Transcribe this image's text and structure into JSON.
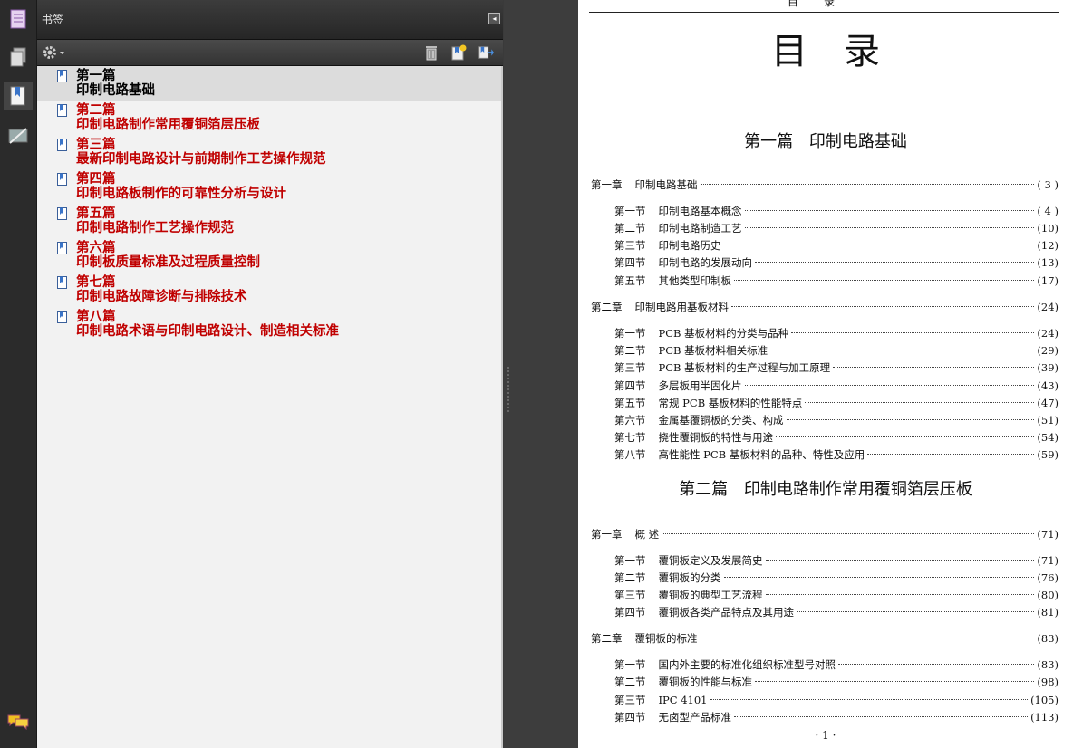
{
  "panel": {
    "title": "书签",
    "collapse_glyph": "◂"
  },
  "bookmarks": [
    {
      "line1": "第一篇",
      "line2": "印制电路基础",
      "selected": true
    },
    {
      "line1": "第二篇",
      "line2": "印制电路制作常用覆铜箔层压板"
    },
    {
      "line1": "第三篇",
      "line2": "最新印制电路设计与前期制作工艺操作规范"
    },
    {
      "line1": "第四篇",
      "line2": "印制电路板制作的可靠性分析与设计"
    },
    {
      "line1": "第五篇",
      "line2": "印制电路制作工艺操作规范"
    },
    {
      "line1": "第六篇",
      "line2": "印制板质量标准及过程质量控制"
    },
    {
      "line1": "第七篇",
      "line2": "印制电路故障诊断与排除技术"
    },
    {
      "line1": "第八篇",
      "line2": "印制电路术语与印制电路设计、制造相关标准"
    }
  ],
  "document": {
    "running_head": "目录",
    "title": "目录",
    "part1_title": "第一篇  印制电路基础",
    "part2_title": "第二篇  印制电路制作常用覆铜箔层压板",
    "folio": "· 1 ·",
    "toc": [
      {
        "label": "第一章",
        "title": "印制电路基础",
        "page": "( 3 )"
      },
      {
        "label": "第一节",
        "title": "印制电路基本概念",
        "page": "( 4 )"
      },
      {
        "label": "第二节",
        "title": "印制电路制造工艺",
        "page": "(10)"
      },
      {
        "label": "第三节",
        "title": "印制电路历史",
        "page": "(12)"
      },
      {
        "label": "第四节",
        "title": "印制电路的发展动向",
        "page": "(13)"
      },
      {
        "label": "第五节",
        "title": "其他类型印制板",
        "page": "(17)"
      },
      {
        "label": "第二章",
        "title": "印制电路用基板材料",
        "page": "(24)"
      },
      {
        "label": "第一节",
        "title": "PCB 基板材料的分类与品种",
        "page": "(24)"
      },
      {
        "label": "第二节",
        "title": "PCB 基板材料相关标准",
        "page": "(29)"
      },
      {
        "label": "第三节",
        "title": "PCB 基板材料的生产过程与加工原理",
        "page": "(39)"
      },
      {
        "label": "第四节",
        "title": "多层板用半固化片",
        "page": "(43)"
      },
      {
        "label": "第五节",
        "title": "常规 PCB 基板材料的性能特点",
        "page": "(47)"
      },
      {
        "label": "第六节",
        "title": "金属基覆铜板的分类、构成",
        "page": "(51)"
      },
      {
        "label": "第七节",
        "title": "挠性覆铜板的特性与用途",
        "page": "(54)"
      },
      {
        "label": "第八节",
        "title": "高性能性 PCB 基板材料的品种、特性及应用",
        "page": "(59)"
      },
      {
        "label": "第一章",
        "title": "概  述",
        "page": "(71)"
      },
      {
        "label": "第一节",
        "title": "覆铜板定义及发展简史",
        "page": "(71)"
      },
      {
        "label": "第二节",
        "title": "覆铜板的分类",
        "page": "(76)"
      },
      {
        "label": "第三节",
        "title": "覆铜板的典型工艺流程",
        "page": "(80)"
      },
      {
        "label": "第四节",
        "title": "覆铜板各类产品特点及其用途",
        "page": "(81)"
      },
      {
        "label": "第二章",
        "title": "覆铜板的标准",
        "page": "(83)"
      },
      {
        "label": "第一节",
        "title": "国内外主要的标准化组织标准型号对照",
        "page": "(83)"
      },
      {
        "label": "第二节",
        "title": "覆铜板的性能与标准",
        "page": "(98)"
      },
      {
        "label": "第三节",
        "title": "IPC 4101",
        "page": "(105)"
      },
      {
        "label": "第四节",
        "title": "无卤型产品标准",
        "page": "(113)"
      }
    ]
  }
}
